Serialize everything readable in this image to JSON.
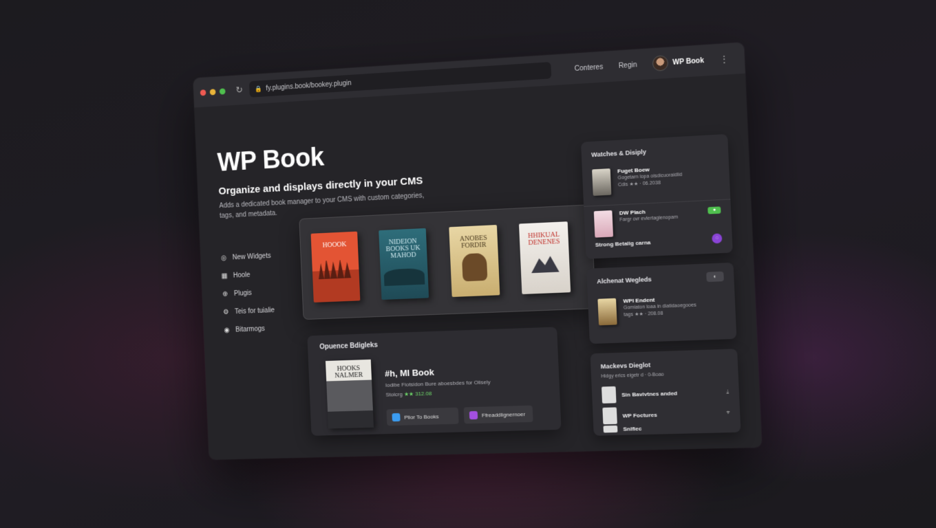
{
  "browser": {
    "url": "fy.plugins.book/bookey.plugin",
    "nav_links": [
      "Conteres",
      "Regin"
    ],
    "user_name": "WP Book"
  },
  "hero": {
    "title": "WP Book",
    "subtitle": "Organize and displays directly in your CMS",
    "description": "Adds a dedicated book manager to your CMS with custom categories, tags, and metadata."
  },
  "sidebar": {
    "items": [
      {
        "label": "New Widgets",
        "icon": "circle-icon"
      },
      {
        "label": "Hoole",
        "icon": "grid-icon"
      },
      {
        "label": "Plugis",
        "icon": "globe-icon"
      },
      {
        "label": "Teis for tuialie",
        "icon": "gear-icon"
      },
      {
        "label": "Bitarmogs",
        "icon": "chat-icon"
      }
    ]
  },
  "carousel": {
    "books": [
      {
        "title": "HOOOK"
      },
      {
        "title": "NIDEION BOOKS UK MAHOD"
      },
      {
        "title": "ANOBES FORDIR"
      },
      {
        "title": "HHIKUAL DENENES"
      }
    ]
  },
  "featured": {
    "section_label": "Opuence Bdigleks",
    "cover_title": "HOOKS NALMER",
    "title": "#h, MI Book",
    "description": "Iodibe Fiotsidon Bure aboesbdes for Olisely",
    "rating_label": "Stolcrg",
    "rating_stars": "★★",
    "rating_value": "312.08",
    "button_primary": "Plior To Books",
    "button_secondary": "Ffreaddlignernoer"
  },
  "right_panels": {
    "panel1": {
      "title": "Watches & Disiply",
      "item1_title": "Fuget Boew",
      "item1_sub": "Gogetarn lopa oisdicuoraidlid",
      "item1_meta": "Cdis ★★ · 06.2038",
      "item2_title": "DW Plach",
      "item2_sub": "Fargr ovr evlertaglenopam",
      "item3_title": "Strong Betalig carna"
    },
    "panel2": {
      "title": "Alchenat Wegleds",
      "item_title": "WPI Endent",
      "item_sub": "Gomiaton loaa in diatidaoegooes",
      "item_meta": "tags ★★ · 208.08"
    },
    "panel3": {
      "title": "Mackevs Dieglot",
      "sub": "Hidgy erlcs eigetr d · 0-Boao",
      "row1": "Sin Bavivtnes anded",
      "row2": "WP Foctures",
      "row3": "Snlfiec"
    }
  }
}
